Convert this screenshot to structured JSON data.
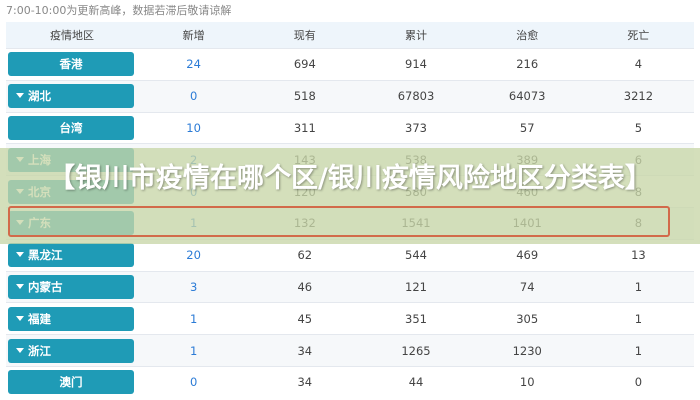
{
  "notice": "7:00-10:00为更新高峰，数据若滞后敬请谅解",
  "headers": {
    "region": "疫情地区",
    "new": "新增",
    "current": "现有",
    "total": "累计",
    "cured": "治愈",
    "dead": "死亡"
  },
  "rows": [
    {
      "region": "香港",
      "expand": false,
      "new": "24",
      "current": "694",
      "total": "914",
      "cured": "216",
      "dead": "4"
    },
    {
      "region": "湖北",
      "expand": true,
      "new": "0",
      "current": "518",
      "total": "67803",
      "cured": "64073",
      "dead": "3212"
    },
    {
      "region": "台湾",
      "expand": false,
      "new": "10",
      "current": "311",
      "total": "373",
      "cured": "57",
      "dead": "5"
    },
    {
      "region": "上海",
      "expand": true,
      "new": "2",
      "current": "143",
      "total": "538",
      "cured": "389",
      "dead": "6"
    },
    {
      "region": "北京",
      "expand": true,
      "new": "0",
      "current": "120",
      "total": "580",
      "cured": "460",
      "dead": "8"
    },
    {
      "region": "广东",
      "expand": true,
      "new": "1",
      "current": "132",
      "total": "1541",
      "cured": "1401",
      "dead": "8"
    },
    {
      "region": "黑龙江",
      "expand": true,
      "new": "20",
      "current": "62",
      "total": "544",
      "cured": "469",
      "dead": "13"
    },
    {
      "region": "内蒙古",
      "expand": true,
      "new": "3",
      "current": "46",
      "total": "121",
      "cured": "74",
      "dead": "1"
    },
    {
      "region": "福建",
      "expand": true,
      "new": "1",
      "current": "45",
      "total": "351",
      "cured": "305",
      "dead": "1"
    },
    {
      "region": "浙江",
      "expand": true,
      "new": "1",
      "current": "34",
      "total": "1265",
      "cured": "1230",
      "dead": "1"
    },
    {
      "region": "澳门",
      "expand": false,
      "new": "0",
      "current": "34",
      "total": "44",
      "cured": "10",
      "dead": "0"
    }
  ],
  "banner": {
    "title": "【银川市疫情在哪个区/银川疫情风险地区分类表】"
  },
  "colors": {
    "region_pill": "#1f9bb6",
    "new_value": "#2b7bd6",
    "banner_bg": "#c8d6a8",
    "highlight_border": "#d26a4a"
  }
}
